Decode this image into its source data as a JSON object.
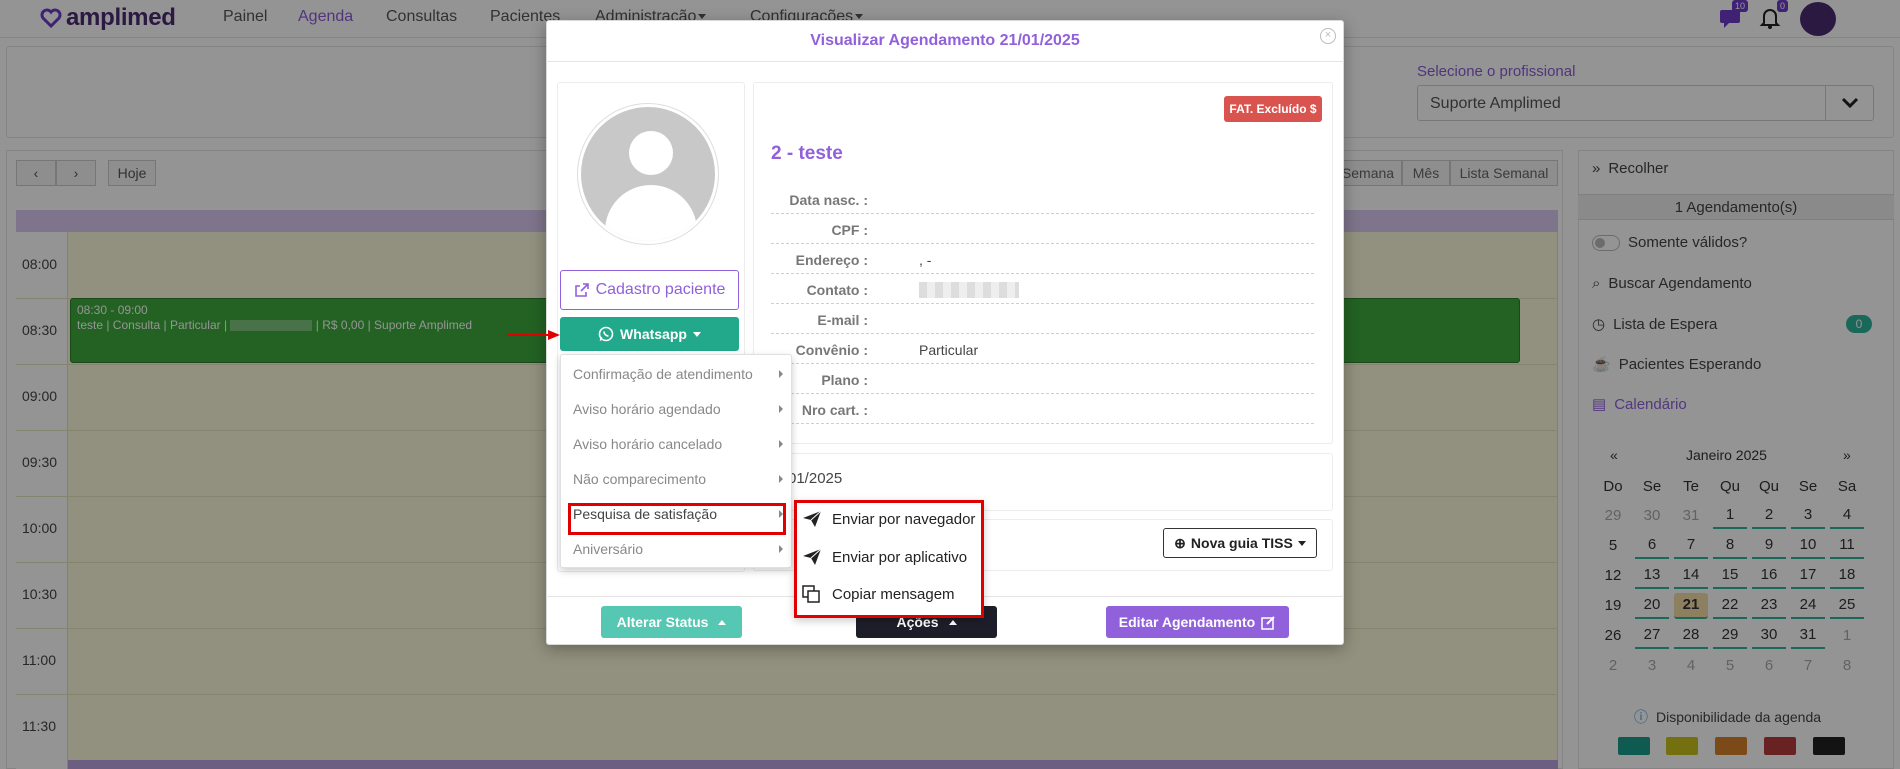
{
  "app": {
    "logo_text": "amplimed",
    "nav": [
      "Painel",
      "Agenda",
      "Consultas",
      "Pacientes",
      "Administração",
      "Configurações"
    ],
    "notif_counts": {
      "chat": "10",
      "bell": "0"
    }
  },
  "filter": {
    "professional_label": "Selecione o profissional",
    "professional_value": "Suporte Amplimed"
  },
  "calendar": {
    "prev": "‹",
    "next": "›",
    "today": "Hoje",
    "views": [
      "Semana",
      "Mês",
      "Lista Semanal"
    ],
    "times": [
      "08:00",
      "08:30",
      "09:00",
      "09:30",
      "10:00",
      "10:30",
      "11:00",
      "11:30"
    ],
    "event": {
      "time": "08:30 - 09:00",
      "desc_prefix": "teste | Consulta | Particular |",
      "desc_suffix": "| R$ 0,00 | Suporte Amplimed"
    }
  },
  "sidebar": {
    "collapse": "Recolher",
    "count_title": "1 Agendamento(s)",
    "only_valid": "Somente válidos?",
    "search": "Buscar Agendamento",
    "waitlist": "Lista de Espera",
    "waitlist_count": "0",
    "waiting": "Pacientes Esperando",
    "calendar": "Calendário",
    "month_nav_prev": "«",
    "month_nav_next": "»",
    "month_label": "Janeiro 2025",
    "weekdays": [
      "Do",
      "Se",
      "Te",
      "Qu",
      "Qu",
      "Se",
      "Sa"
    ],
    "weeks": [
      [
        "29",
        "30",
        "31",
        "1",
        "2",
        "3",
        "4"
      ],
      [
        "5",
        "6",
        "7",
        "8",
        "9",
        "10",
        "11"
      ],
      [
        "12",
        "13",
        "14",
        "15",
        "16",
        "17",
        "18"
      ],
      [
        "19",
        "20",
        "21",
        "22",
        "23",
        "24",
        "25"
      ],
      [
        "26",
        "27",
        "28",
        "29",
        "30",
        "31",
        "1"
      ],
      [
        "2",
        "3",
        "4",
        "5",
        "6",
        "7",
        "8"
      ]
    ],
    "availability": "Disponibilidade da agenda",
    "legend_colors": [
      "#1a9e8c",
      "#c9c21a",
      "#d67f2c",
      "#b33b3b",
      "#222222"
    ]
  },
  "modal": {
    "title": "Visualizar Agendamento 21/01/2025",
    "close": "×",
    "btn_cadastro": "Cadastro paciente",
    "btn_whatsapp": "Whatsapp",
    "badge": "FAT. Excluído $",
    "patient_name": "2 - teste",
    "fields": [
      {
        "label": "Data nasc. :",
        "value": ""
      },
      {
        "label": "CPF :",
        "value": ""
      },
      {
        "label": "Endereço :",
        "value": ", -"
      },
      {
        "label": "Contato :",
        "value": ""
      },
      {
        "label": "E-mail :",
        "value": ""
      },
      {
        "label": "Convênio :",
        "value": "Particular"
      },
      {
        "label": "Plano :",
        "value": ""
      },
      {
        "label": "Nro cart. :",
        "value": ""
      }
    ],
    "date_fragment": "01/2025",
    "btn_tiss": "Nova guia TISS",
    "btn_status": "Alterar Status",
    "btn_acoes": "Ações",
    "btn_editar": "Editar Agendamento"
  },
  "whatsapp_menu": {
    "items": [
      "Confirmação de atendimento",
      "Aviso horário agendado",
      "Aviso horário cancelado",
      "Não comparecimento",
      "Pesquisa de satisfação",
      "Aniversário"
    ],
    "submenu": [
      "Enviar por navegador",
      "Enviar por aplicativo",
      "Copiar mensagem"
    ]
  }
}
